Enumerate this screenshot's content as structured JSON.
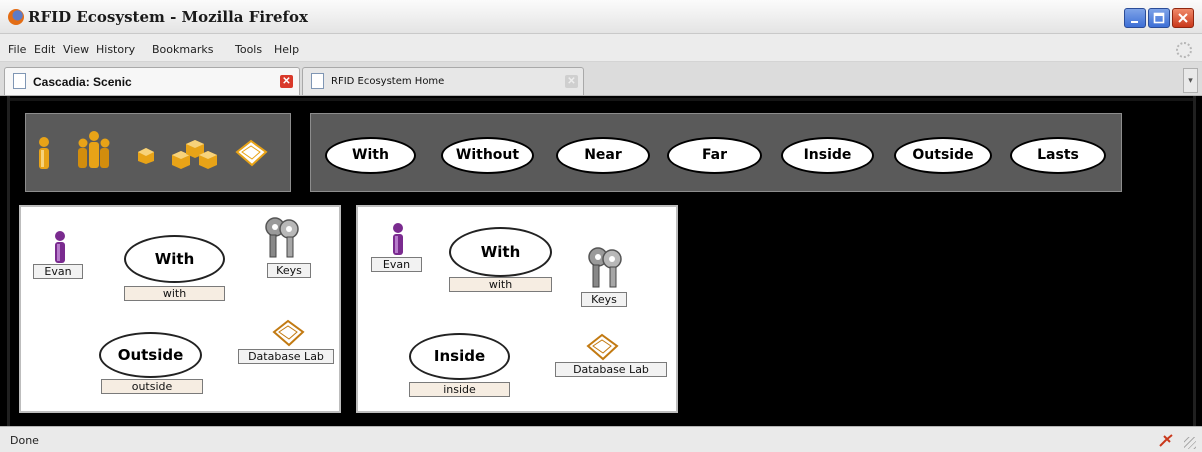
{
  "window": {
    "title": "RFID Ecosystem - Mozilla Firefox",
    "controls": [
      "minimize-icon",
      "maximize-icon",
      "close-icon"
    ],
    "accent": "#3d6fd6",
    "close_color": "#c9381b"
  },
  "menu": {
    "items": [
      {
        "label": "File",
        "name": "menu-file"
      },
      {
        "label": "Edit",
        "name": "menu-edit"
      },
      {
        "label": "View",
        "name": "menu-view"
      },
      {
        "label": "History",
        "name": "menu-history"
      },
      {
        "label": "Bookmarks",
        "name": "menu-bookmarks"
      },
      {
        "label": "Tools",
        "name": "menu-tools"
      },
      {
        "label": "Help",
        "name": "menu-help"
      }
    ]
  },
  "tabs": [
    {
      "label": "Cascadia: Scenic",
      "active": true
    },
    {
      "label": "RFID Ecosystem Home",
      "active": false
    }
  ],
  "palette": {
    "objects": [
      "person-icon",
      "people-group-icon",
      "object-icon",
      "object-group-icon",
      "location-icon"
    ],
    "operators": [
      "With",
      "Without",
      "Near",
      "Far",
      "Inside",
      "Outside",
      "Lasts"
    ]
  },
  "scenario1": {
    "person": {
      "label": "Evan",
      "icon": "person-icon"
    },
    "relation1": {
      "title": "With",
      "label": "with"
    },
    "object": {
      "label": "Keys",
      "icon": "keys-icon"
    },
    "relation2": {
      "title": "Outside",
      "label": "outside"
    },
    "location": {
      "label": "Database Lab",
      "icon": "location-icon"
    }
  },
  "scenario2": {
    "person": {
      "label": "Evan",
      "icon": "person-icon"
    },
    "relation1": {
      "title": "With",
      "label": "with"
    },
    "object": {
      "label": "Keys",
      "icon": "keys-icon"
    },
    "relation2": {
      "title": "Inside",
      "label": "inside"
    },
    "location": {
      "label": "Database Lab",
      "icon": "location-icon"
    }
  },
  "status": {
    "text": "Done"
  },
  "colors": {
    "person_generic": "#e8a317",
    "person_entity": "#7a2b8f",
    "object": "#e8a317",
    "canvas": "#000000",
    "palette_bg": "#5a5a5a"
  }
}
